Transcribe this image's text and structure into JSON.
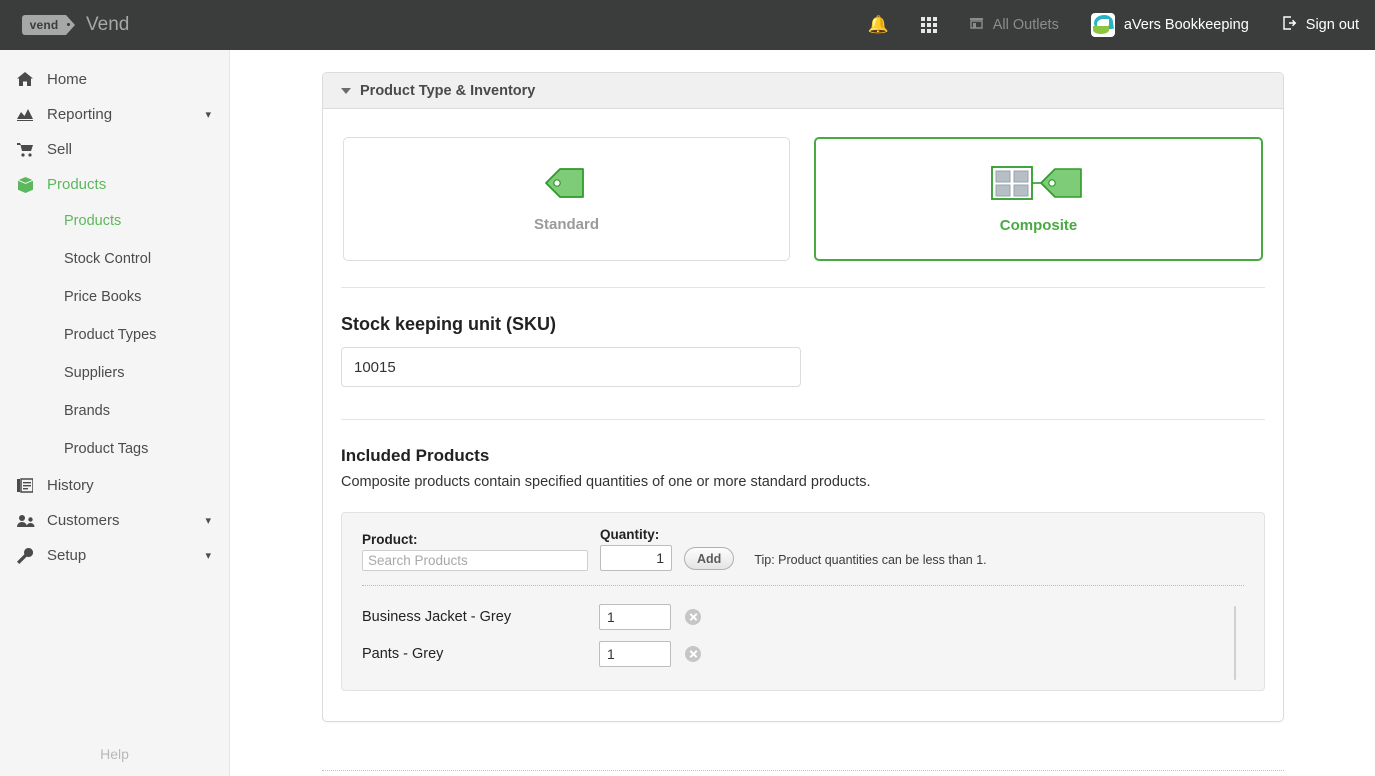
{
  "topbar": {
    "logo_text": "vend",
    "brand_name": "Vend",
    "notifications_icon": "bell-icon",
    "apps_icon": "apps-grid-icon",
    "outlet_icon": "store-icon",
    "outlet_label": "All Outlets",
    "account_logo": "avers-logo-icon",
    "account_label": "aVers Bookkeeping",
    "signout_icon": "sign-out-icon",
    "signout_label": "Sign out"
  },
  "sidebar": {
    "items": [
      {
        "label": "Home",
        "icon": "home-icon",
        "active": false,
        "expandable": false
      },
      {
        "label": "Reporting",
        "icon": "chart-icon",
        "active": false,
        "expandable": true
      },
      {
        "label": "Sell",
        "icon": "cart-icon",
        "active": false,
        "expandable": false
      },
      {
        "label": "Products",
        "icon": "box-icon",
        "active": true,
        "expandable": false
      },
      {
        "label": "History",
        "icon": "book-icon",
        "active": false,
        "expandable": false
      },
      {
        "label": "Customers",
        "icon": "people-icon",
        "active": false,
        "expandable": true
      },
      {
        "label": "Setup",
        "icon": "wrench-icon",
        "active": false,
        "expandable": true
      }
    ],
    "sub_items": [
      {
        "label": "Products",
        "active": true
      },
      {
        "label": "Stock Control",
        "active": false
      },
      {
        "label": "Price Books",
        "active": false
      },
      {
        "label": "Product Types",
        "active": false
      },
      {
        "label": "Suppliers",
        "active": false
      },
      {
        "label": "Brands",
        "active": false
      },
      {
        "label": "Product Tags",
        "active": false
      }
    ],
    "help_label": "Help"
  },
  "panel": {
    "title": "Product Type & Inventory",
    "collapse_icon": "caret-down-icon"
  },
  "product_type": {
    "options": [
      {
        "label": "Standard",
        "icon": "tag-icon",
        "selected": false
      },
      {
        "label": "Composite",
        "icon": "composite-tag-icon",
        "selected": true
      }
    ]
  },
  "sku": {
    "label": "Stock keeping unit (SKU)",
    "value": "10015"
  },
  "included_products": {
    "heading": "Included Products",
    "description": "Composite products contain specified quantities of one or more standard products.",
    "product_label": "Product:",
    "product_placeholder": "Search Products",
    "product_value": "",
    "quantity_label": "Quantity:",
    "quantity_value": "1",
    "add_label": "Add",
    "tip": "Tip: Product quantities can be less than 1.",
    "rows": [
      {
        "name": "Business Jacket - Grey",
        "qty": "1",
        "remove_icon": "remove-circle-icon"
      },
      {
        "name": "Pants - Grey",
        "qty": "1",
        "remove_icon": "remove-circle-icon"
      }
    ]
  },
  "colors": {
    "accent_green": "#49a942",
    "topbar_bg": "#3b3d3c",
    "sidebar_bg": "#f5f5f5",
    "panel_header_bg": "#f0f0f0"
  }
}
